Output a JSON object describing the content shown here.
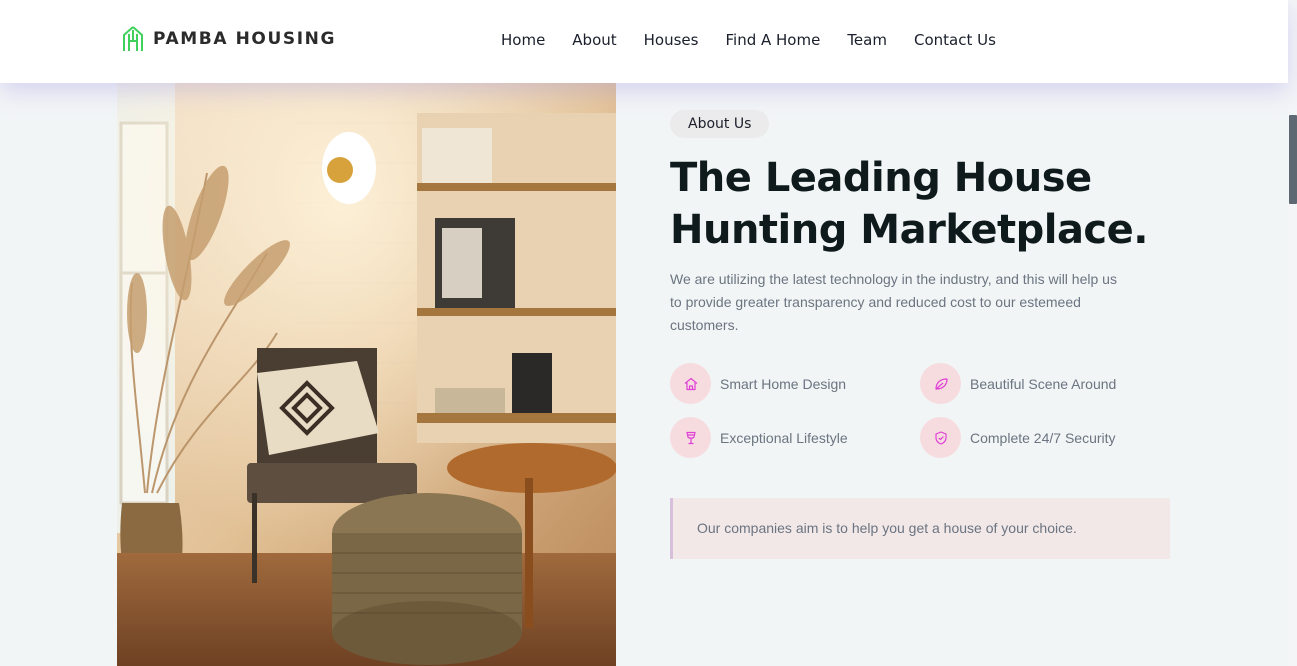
{
  "brand": {
    "name": "PAMBA HOUSING",
    "logo_icon": "house-h-logo-icon",
    "logo_color": "#3fd15b"
  },
  "nav": {
    "items": [
      {
        "label": "Home"
      },
      {
        "label": "About"
      },
      {
        "label": "Houses"
      },
      {
        "label": "Find A Home"
      },
      {
        "label": "Team"
      },
      {
        "label": "Contact Us"
      }
    ]
  },
  "about": {
    "tag": "About Us",
    "headline_line1": "The Leading House",
    "headline_line2": "Hunting Marketplace.",
    "description": "We are utilizing the latest technology in the industry, and this will help us to provide greater transparency and reduced cost to our estemeed customers.",
    "features": [
      {
        "label": "Smart Home Design",
        "icon": "home-icon"
      },
      {
        "label": "Beautiful Scene Around",
        "icon": "leaf-icon"
      },
      {
        "label": "Exceptional Lifestyle",
        "icon": "wine-glass-icon"
      },
      {
        "label": "Complete 24/7 Security",
        "icon": "shield-icon"
      }
    ],
    "quote": "Our companies aim is to help you get a house of your choice."
  },
  "colors": {
    "accent": "#e040d6",
    "icon_bg": "#f6dcdf",
    "headline": "#0f1a1c",
    "body_text": "#6b7480"
  }
}
